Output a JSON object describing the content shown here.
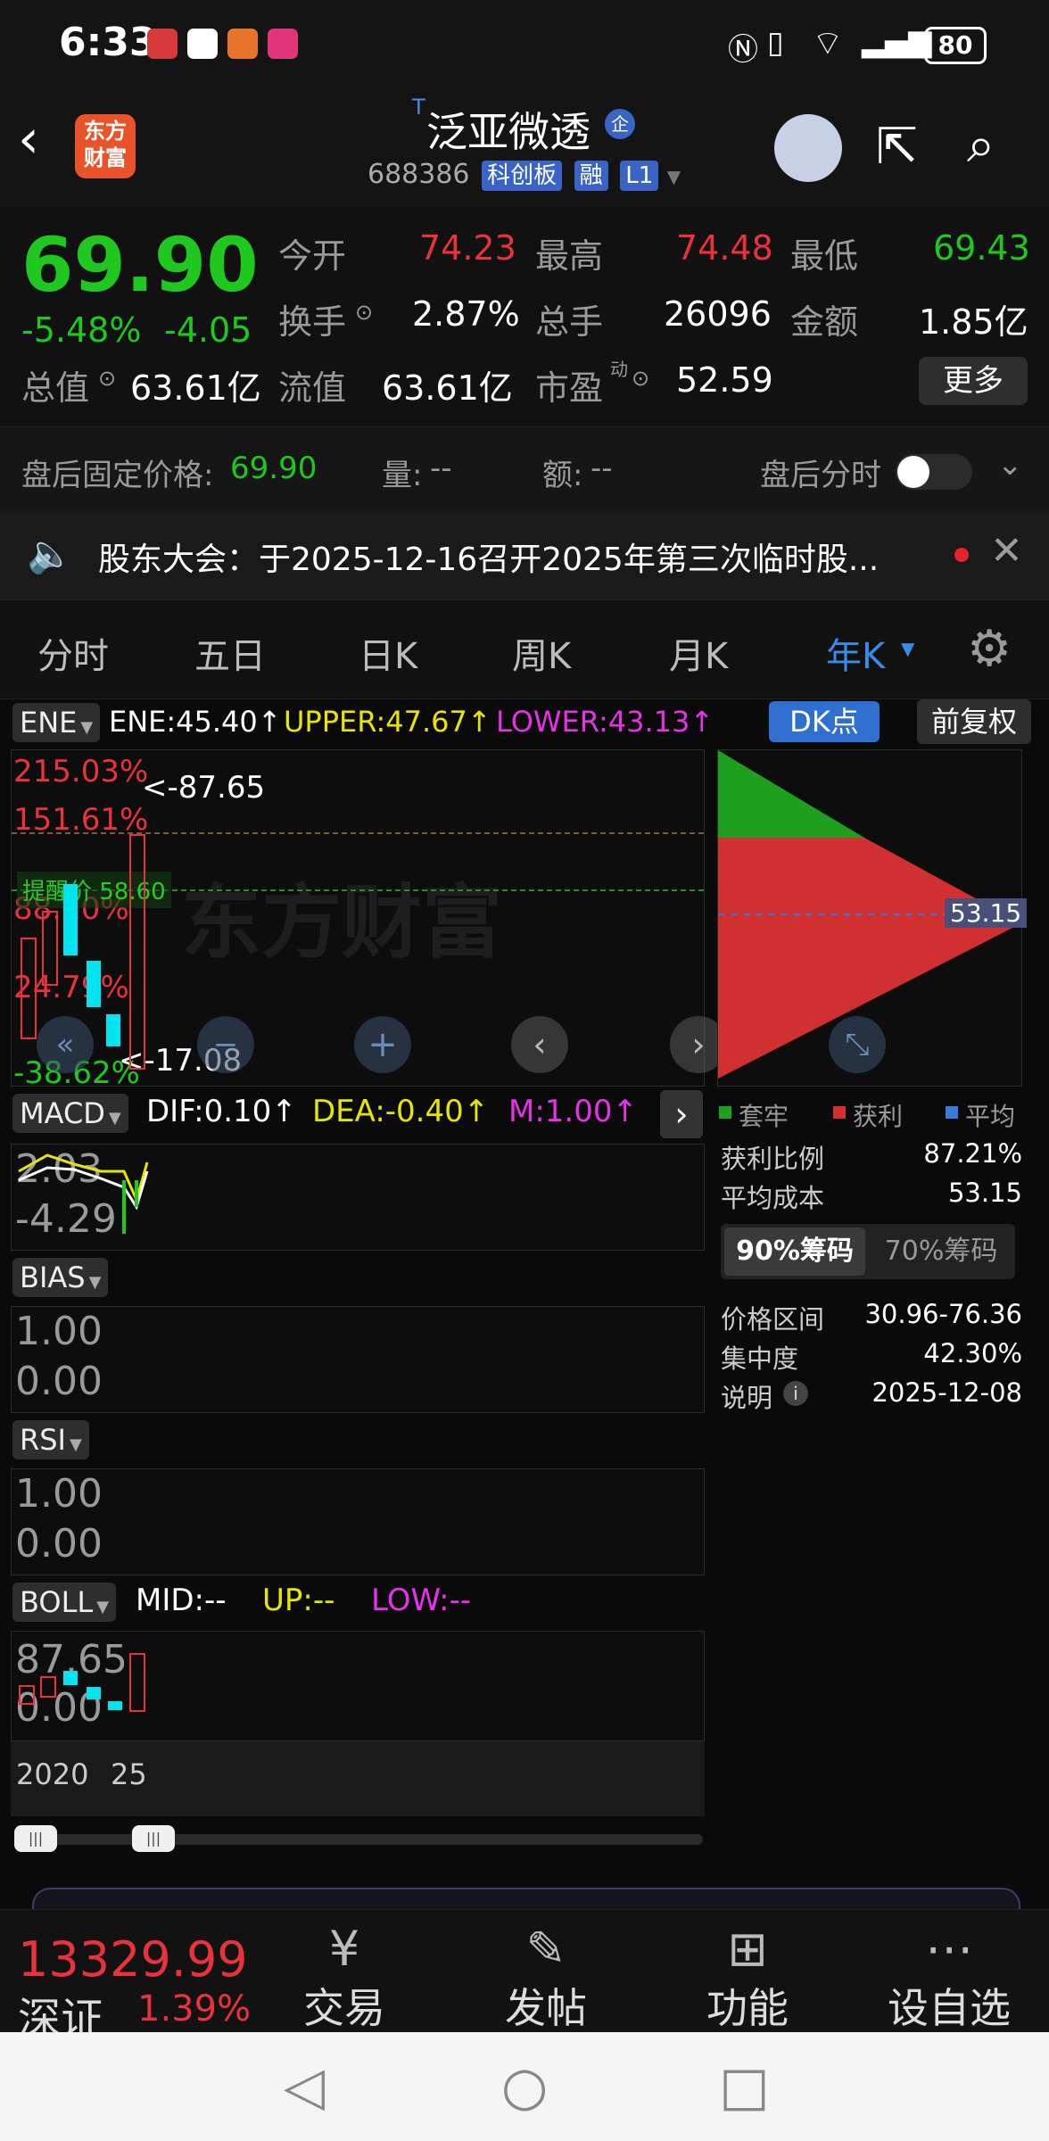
{
  "status": {
    "time": "6:33",
    "battery": "80"
  },
  "header": {
    "title": "泛亚微透",
    "title_sup": "T",
    "code": "688386",
    "badge_board": "科创板",
    "badge_margin": "融",
    "badge_level": "L1",
    "logo_text_1": "东方",
    "logo_text_2": "财富"
  },
  "quote": {
    "price": "69.90",
    "change_pct": "-5.48%",
    "change": "-4.05",
    "open_label": "今开",
    "open": "74.23",
    "high_label": "最高",
    "high": "74.48",
    "low_label": "最低",
    "low": "69.43",
    "turnover_label": "换手",
    "turnover": "2.87%",
    "volume_label": "总手",
    "volume": "26096",
    "amount_label": "金额",
    "amount": "1.85亿",
    "mktcap_label": "总值",
    "mktcap": "63.61亿",
    "float_label": "流值",
    "float": "63.61亿",
    "pe_label": "市盈",
    "pe_sup": "动",
    "pe": "52.59",
    "more_button": "更多"
  },
  "afterhours": {
    "fixed_price_label": "盘后固定价格:",
    "fixed_price": "69.90",
    "vol_label": "量:",
    "vol": "--",
    "amt_label": "额:",
    "amt": "--",
    "toggle_label": "盘后分时"
  },
  "notice": {
    "text": "股东大会：于2025-12-16召开2025年第三次临时股..."
  },
  "tabs": [
    "分时",
    "五日",
    "日K",
    "周K",
    "月K",
    "年K"
  ],
  "ene": {
    "name": "ENE",
    "ene_val": "ENE:45.40↑",
    "upper": "UPPER:47.67↑",
    "lower": "LOWER:43.13↑",
    "dk_button": "DK点",
    "fq_button": "前复权",
    "y_labels": [
      "215.03%",
      "151.61%",
      "88.20%",
      "24.79%",
      "-38.62%"
    ],
    "high_mark": "<-87.65",
    "low_mark": "<-17.08",
    "alert_label": "提醒价 58.60",
    "watermark": "东方财富"
  },
  "chips": {
    "avg_marker": "53.15",
    "legend": [
      "套牢",
      "获利",
      "平均"
    ],
    "legend_colors": [
      "#1ea01e",
      "#d03030",
      "#3a7bd5"
    ],
    "profit_ratio_label": "获利比例",
    "profit_ratio": "87.21%",
    "avg_cost_label": "平均成本",
    "avg_cost": "53.15",
    "tab_90": "90%筹码",
    "tab_70": "70%筹码",
    "range_label": "价格区间",
    "range": "30.96-76.36",
    "concentration_label": "集中度",
    "concentration": "42.30%",
    "note_label": "说明",
    "note": "2025-12-08",
    "holder_fraction": 0.1279,
    "profit_fraction": 0.8721
  },
  "macd": {
    "name": "MACD",
    "dif": "DIF:0.10↑",
    "dea": "DEA:-0.40↑",
    "m": "M:1.00↑",
    "y_top": "2.03",
    "y_bottom": "-4.29"
  },
  "bias": {
    "name": "BIAS",
    "y_top": "1.00",
    "y_bottom": "0.00"
  },
  "rsi": {
    "name": "RSI",
    "y_top": "1.00",
    "y_bottom": "0.00"
  },
  "boll": {
    "name": "BOLL",
    "mid": "MID:--",
    "up": "UP:--",
    "low": "LOW:--",
    "y_top": "87.65",
    "y_bottom": "0.00",
    "x_start": "2020",
    "x_end": "25"
  },
  "bottom": {
    "index_value": "13329.99",
    "index_name": "深证",
    "index_pct": "1.39%",
    "items": [
      "交易",
      "发帖",
      "功能",
      "设自选"
    ]
  }
}
